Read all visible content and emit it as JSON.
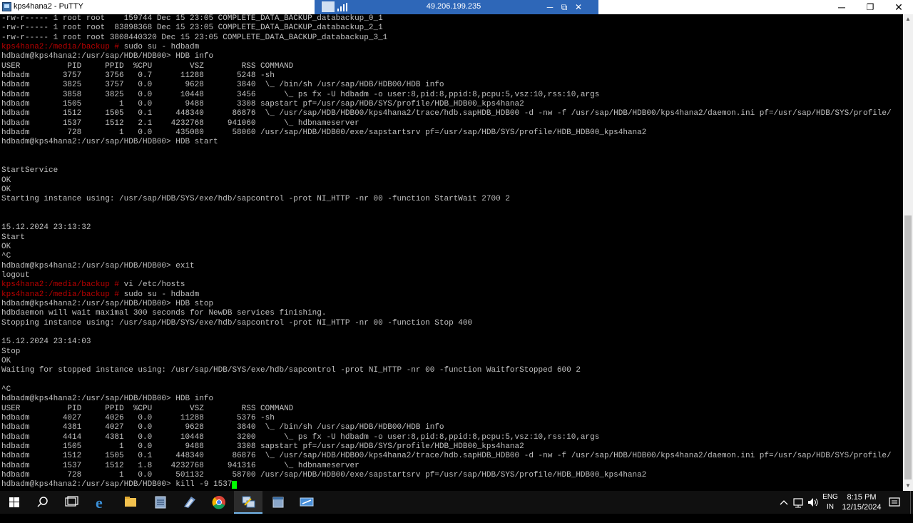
{
  "window": {
    "title": "kps4hana2 - PuTTY",
    "minimize": "─",
    "maximize": "❐",
    "close": "✕"
  },
  "remote_bar": {
    "ip": "49.206.199.235",
    "minimize": "─",
    "restore": "⧉",
    "close": "✕"
  },
  "terminal": {
    "lines": [
      {
        "segments": [
          {
            "t": "-rw-r----- 1 root root    159744 Dec 15 23:05 COMPLETE_DATA_BACKUP_databackup_0_1"
          }
        ]
      },
      {
        "segments": [
          {
            "t": "-rw-r----- 1 root root  83898368 Dec 15 23:05 COMPLETE_DATA_BACKUP_databackup_2_1"
          }
        ]
      },
      {
        "segments": [
          {
            "t": "-rw-r----- 1 root root 3808440320 Dec 15 23:05 COMPLETE_DATA_BACKUP_databackup_3_1"
          }
        ]
      },
      {
        "segments": [
          {
            "t": "kps4hana2:/media/backup #",
            "c": "red"
          },
          {
            "t": " sudo su - hdbadm"
          }
        ]
      },
      {
        "segments": [
          {
            "t": "hdbadm@kps4hana2:/usr/sap/HDB/HDB00> HDB info"
          }
        ]
      },
      {
        "segments": [
          {
            "t": "USER          PID     PPID  %CPU        VSZ        RSS COMMAND"
          }
        ]
      },
      {
        "segments": [
          {
            "t": "hdbadm       3757     3756   0.7      11288       5248 -sh"
          }
        ]
      },
      {
        "segments": [
          {
            "t": "hdbadm       3825     3757   0.0       9628       3840  \\_ /bin/sh /usr/sap/HDB/HDB00/HDB info"
          }
        ]
      },
      {
        "segments": [
          {
            "t": "hdbadm       3858     3825   0.0      10448       3456      \\_ ps fx -U hdbadm -o user:8,pid:8,ppid:8,pcpu:5,vsz:10,rss:10,args"
          }
        ]
      },
      {
        "segments": [
          {
            "t": "hdbadm       1505        1   0.0       9488       3308 sapstart pf=/usr/sap/HDB/SYS/profile/HDB_HDB00_kps4hana2"
          }
        ]
      },
      {
        "segments": [
          {
            "t": "hdbadm       1512     1505   0.1     448340      86876  \\_ /usr/sap/HDB/HDB00/kps4hana2/trace/hdb.sapHDB_HDB00 -d -nw -f /usr/sap/HDB/HDB00/kps4hana2/daemon.ini pf=/usr/sap/HDB/SYS/profile/"
          }
        ]
      },
      {
        "segments": [
          {
            "t": "hdbadm       1537     1512   2.1    4232768     941060      \\_ hdbnameserver"
          }
        ]
      },
      {
        "segments": [
          {
            "t": "hdbadm        728        1   0.0     435080      58060 /usr/sap/HDB/HDB00/exe/sapstartsrv pf=/usr/sap/HDB/SYS/profile/HDB_HDB00_kps4hana2"
          }
        ]
      },
      {
        "segments": [
          {
            "t": "hdbadm@kps4hana2:/usr/sap/HDB/HDB00> HDB start"
          }
        ]
      },
      {
        "segments": [
          {
            "t": ""
          }
        ]
      },
      {
        "segments": [
          {
            "t": ""
          }
        ]
      },
      {
        "segments": [
          {
            "t": "StartService"
          }
        ]
      },
      {
        "segments": [
          {
            "t": "OK"
          }
        ]
      },
      {
        "segments": [
          {
            "t": "OK"
          }
        ]
      },
      {
        "segments": [
          {
            "t": "Starting instance using: /usr/sap/HDB/SYS/exe/hdb/sapcontrol -prot NI_HTTP -nr 00 -function StartWait 2700 2"
          }
        ]
      },
      {
        "segments": [
          {
            "t": ""
          }
        ]
      },
      {
        "segments": [
          {
            "t": ""
          }
        ]
      },
      {
        "segments": [
          {
            "t": "15.12.2024 23:13:32"
          }
        ]
      },
      {
        "segments": [
          {
            "t": "Start"
          }
        ]
      },
      {
        "segments": [
          {
            "t": "OK"
          }
        ]
      },
      {
        "segments": [
          {
            "t": "^C"
          }
        ]
      },
      {
        "segments": [
          {
            "t": "hdbadm@kps4hana2:/usr/sap/HDB/HDB00> exit"
          }
        ]
      },
      {
        "segments": [
          {
            "t": "logout"
          }
        ]
      },
      {
        "segments": [
          {
            "t": "kps4hana2:/media/backup #",
            "c": "red"
          },
          {
            "t": " vi /etc/hosts"
          }
        ]
      },
      {
        "segments": [
          {
            "t": "kps4hana2:/media/backup #",
            "c": "red"
          },
          {
            "t": " sudo su - hdbadm"
          }
        ]
      },
      {
        "segments": [
          {
            "t": "hdbadm@kps4hana2:/usr/sap/HDB/HDB00> HDB stop"
          }
        ]
      },
      {
        "segments": [
          {
            "t": "hdbdaemon will wait maximal 300 seconds for NewDB services finishing."
          }
        ]
      },
      {
        "segments": [
          {
            "t": "Stopping instance using: /usr/sap/HDB/SYS/exe/hdb/sapcontrol -prot NI_HTTP -nr 00 -function Stop 400"
          }
        ]
      },
      {
        "segments": [
          {
            "t": ""
          }
        ]
      },
      {
        "segments": [
          {
            "t": "15.12.2024 23:14:03"
          }
        ]
      },
      {
        "segments": [
          {
            "t": "Stop"
          }
        ]
      },
      {
        "segments": [
          {
            "t": "OK"
          }
        ]
      },
      {
        "segments": [
          {
            "t": "Waiting for stopped instance using: /usr/sap/HDB/SYS/exe/hdb/sapcontrol -prot NI_HTTP -nr 00 -function WaitforStopped 600 2"
          }
        ]
      },
      {
        "segments": [
          {
            "t": ""
          }
        ]
      },
      {
        "segments": [
          {
            "t": "^C"
          }
        ]
      },
      {
        "segments": [
          {
            "t": "hdbadm@kps4hana2:/usr/sap/HDB/HDB00> HDB info"
          }
        ]
      },
      {
        "segments": [
          {
            "t": "USER          PID     PPID  %CPU        VSZ        RSS COMMAND"
          }
        ]
      },
      {
        "segments": [
          {
            "t": "hdbadm       4027     4026   0.0      11288       5376 -sh"
          }
        ]
      },
      {
        "segments": [
          {
            "t": "hdbadm       4381     4027   0.0       9628       3840  \\_ /bin/sh /usr/sap/HDB/HDB00/HDB info"
          }
        ]
      },
      {
        "segments": [
          {
            "t": "hdbadm       4414     4381   0.0      10448       3200      \\_ ps fx -U hdbadm -o user:8,pid:8,ppid:8,pcpu:5,vsz:10,rss:10,args"
          }
        ]
      },
      {
        "segments": [
          {
            "t": "hdbadm       1505        1   0.0       9488       3308 sapstart pf=/usr/sap/HDB/SYS/profile/HDB_HDB00_kps4hana2"
          }
        ]
      },
      {
        "segments": [
          {
            "t": "hdbadm       1512     1505   0.1     448340      86876  \\_ /usr/sap/HDB/HDB00/kps4hana2/trace/hdb.sapHDB_HDB00 -d -nw -f /usr/sap/HDB/HDB00/kps4hana2/daemon.ini pf=/usr/sap/HDB/SYS/profile/"
          }
        ]
      },
      {
        "segments": [
          {
            "t": "hdbadm       1537     1512   1.8    4232768     941316      \\_ hdbnameserver"
          }
        ]
      },
      {
        "segments": [
          {
            "t": "hdbadm        728        1   0.0     501132      58700 /usr/sap/HDB/HDB00/exe/sapstartsrv pf=/usr/sap/HDB/SYS/profile/HDB_HDB00_kps4hana2"
          }
        ]
      },
      {
        "segments": [
          {
            "t": "hdbadm@kps4hana2:/usr/sap/HDB/HDB00> kill -9 1537"
          }
        ],
        "cursor": true
      }
    ]
  },
  "taskbar": {
    "apps": [
      "start-icon",
      "search-icon",
      "task-view-icon",
      "edge-icon",
      "file-explorer-icon",
      "notepad-icon",
      "app-icon",
      "chrome-icon",
      "putty-icon",
      "window-icon",
      "remote-desktop-icon"
    ],
    "lang": {
      "line1": "ENG",
      "line2": "IN"
    },
    "clock": {
      "time": "8:15 PM",
      "date": "12/15/2024"
    }
  },
  "colors": {
    "prompt_red": "#bb0000",
    "text": "#c0c0c0",
    "cursor": "#00ff00",
    "rdp_bar": "#2e67b8",
    "taskbar": "#101010"
  }
}
